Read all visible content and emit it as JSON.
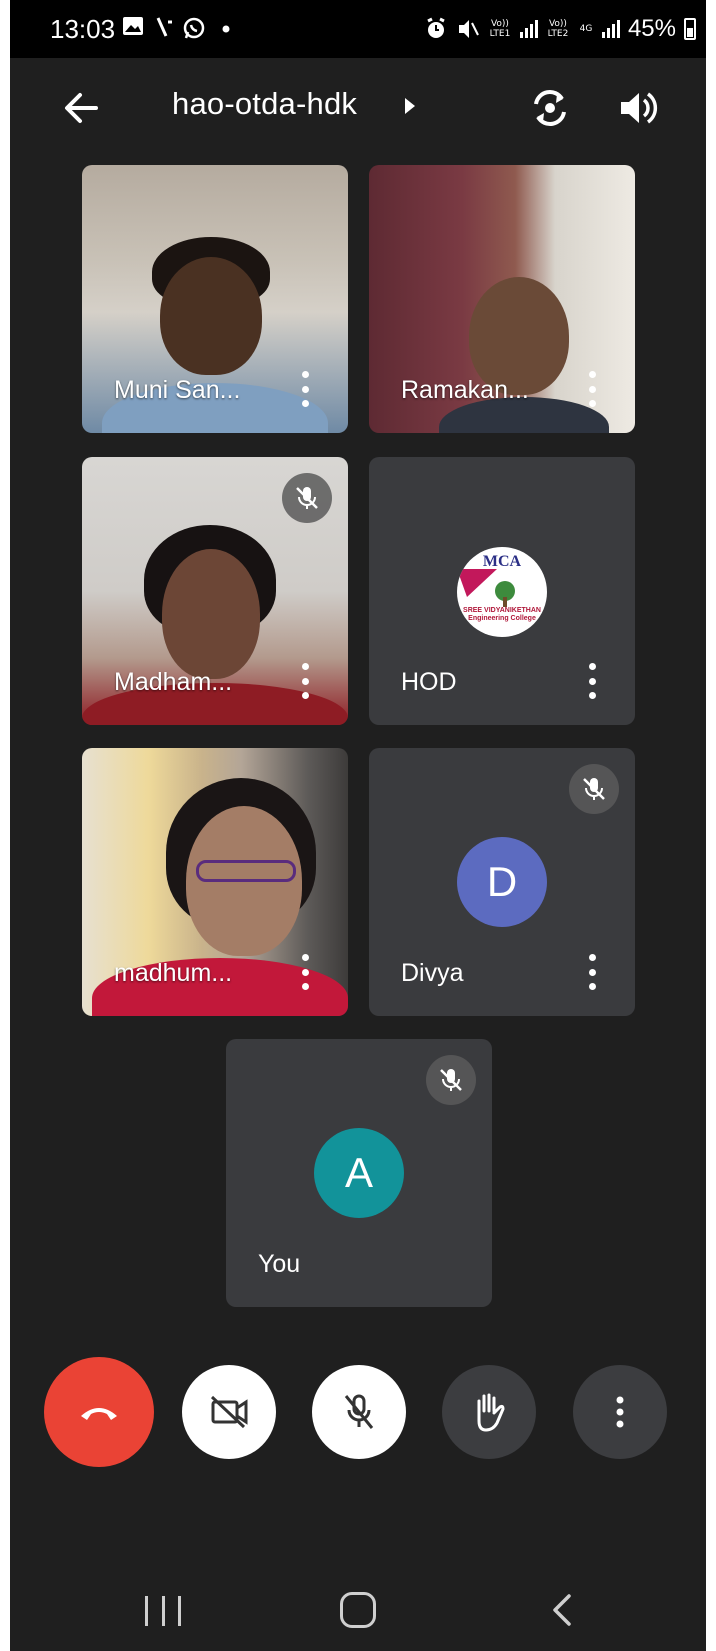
{
  "status_bar": {
    "time": "13:03",
    "network_1": "Vo)) LTE1",
    "network_2": "Vo)) LTE2",
    "network_type": "4G",
    "battery": "45%"
  },
  "header": {
    "meeting_code": "hao-otda-hdk",
    "icons": [
      "back-arrow-icon",
      "switch-camera-icon",
      "speaker-icon"
    ]
  },
  "participants": [
    {
      "name": "Muni San...",
      "muted": false,
      "has_video": true
    },
    {
      "name": "Ramakan...",
      "muted": false,
      "has_video": true
    },
    {
      "name": "Madham...",
      "muted": true,
      "has_video": true
    },
    {
      "name": "HOD",
      "muted": false,
      "has_video": false,
      "logo_top": "MCA",
      "logo_bottom": "SREE VIDYANIKETHAN Engineering College"
    },
    {
      "name": "madhum...",
      "muted": false,
      "has_video": true
    },
    {
      "name": "Divya",
      "muted": true,
      "has_video": false,
      "initial": "D",
      "avatar_color": "#5c6bc0"
    },
    {
      "name": "You",
      "muted": true,
      "has_video": false,
      "initial": "A",
      "avatar_color": "#12939a"
    }
  ],
  "controls": {
    "items": [
      "end-call",
      "camera-off",
      "microphone-off",
      "raise-hand",
      "more-options"
    ],
    "hangup_color": "#ea4335"
  },
  "nav_bar": {
    "items": [
      "recent-apps",
      "home",
      "back"
    ]
  }
}
